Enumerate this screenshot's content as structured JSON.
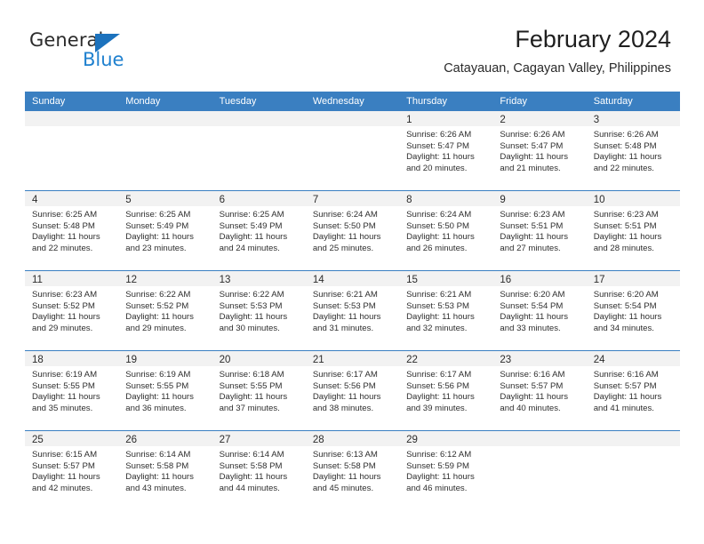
{
  "brand": {
    "word_one": "General",
    "word_two": "Blue",
    "flag_icon": "triangle-flag-icon",
    "accent_color": "#2081cf"
  },
  "header": {
    "title": "February 2024",
    "subtitle": "Catayauan, Cagayan Valley, Philippines"
  },
  "calendar": {
    "header_color": "#3a7fc1",
    "weekdays": [
      "Sunday",
      "Monday",
      "Tuesday",
      "Wednesday",
      "Thursday",
      "Friday",
      "Saturday"
    ],
    "weeks": [
      [
        {
          "day": "",
          "lines": []
        },
        {
          "day": "",
          "lines": []
        },
        {
          "day": "",
          "lines": []
        },
        {
          "day": "",
          "lines": []
        },
        {
          "day": "1",
          "lines": [
            "Sunrise: 6:26 AM",
            "Sunset: 5:47 PM",
            "Daylight: 11 hours",
            "and 20 minutes."
          ]
        },
        {
          "day": "2",
          "lines": [
            "Sunrise: 6:26 AM",
            "Sunset: 5:47 PM",
            "Daylight: 11 hours",
            "and 21 minutes."
          ]
        },
        {
          "day": "3",
          "lines": [
            "Sunrise: 6:26 AM",
            "Sunset: 5:48 PM",
            "Daylight: 11 hours",
            "and 22 minutes."
          ]
        }
      ],
      [
        {
          "day": "4",
          "lines": [
            "Sunrise: 6:25 AM",
            "Sunset: 5:48 PM",
            "Daylight: 11 hours",
            "and 22 minutes."
          ]
        },
        {
          "day": "5",
          "lines": [
            "Sunrise: 6:25 AM",
            "Sunset: 5:49 PM",
            "Daylight: 11 hours",
            "and 23 minutes."
          ]
        },
        {
          "day": "6",
          "lines": [
            "Sunrise: 6:25 AM",
            "Sunset: 5:49 PM",
            "Daylight: 11 hours",
            "and 24 minutes."
          ]
        },
        {
          "day": "7",
          "lines": [
            "Sunrise: 6:24 AM",
            "Sunset: 5:50 PM",
            "Daylight: 11 hours",
            "and 25 minutes."
          ]
        },
        {
          "day": "8",
          "lines": [
            "Sunrise: 6:24 AM",
            "Sunset: 5:50 PM",
            "Daylight: 11 hours",
            "and 26 minutes."
          ]
        },
        {
          "day": "9",
          "lines": [
            "Sunrise: 6:23 AM",
            "Sunset: 5:51 PM",
            "Daylight: 11 hours",
            "and 27 minutes."
          ]
        },
        {
          "day": "10",
          "lines": [
            "Sunrise: 6:23 AM",
            "Sunset: 5:51 PM",
            "Daylight: 11 hours",
            "and 28 minutes."
          ]
        }
      ],
      [
        {
          "day": "11",
          "lines": [
            "Sunrise: 6:23 AM",
            "Sunset: 5:52 PM",
            "Daylight: 11 hours",
            "and 29 minutes."
          ]
        },
        {
          "day": "12",
          "lines": [
            "Sunrise: 6:22 AM",
            "Sunset: 5:52 PM",
            "Daylight: 11 hours",
            "and 29 minutes."
          ]
        },
        {
          "day": "13",
          "lines": [
            "Sunrise: 6:22 AM",
            "Sunset: 5:53 PM",
            "Daylight: 11 hours",
            "and 30 minutes."
          ]
        },
        {
          "day": "14",
          "lines": [
            "Sunrise: 6:21 AM",
            "Sunset: 5:53 PM",
            "Daylight: 11 hours",
            "and 31 minutes."
          ]
        },
        {
          "day": "15",
          "lines": [
            "Sunrise: 6:21 AM",
            "Sunset: 5:53 PM",
            "Daylight: 11 hours",
            "and 32 minutes."
          ]
        },
        {
          "day": "16",
          "lines": [
            "Sunrise: 6:20 AM",
            "Sunset: 5:54 PM",
            "Daylight: 11 hours",
            "and 33 minutes."
          ]
        },
        {
          "day": "17",
          "lines": [
            "Sunrise: 6:20 AM",
            "Sunset: 5:54 PM",
            "Daylight: 11 hours",
            "and 34 minutes."
          ]
        }
      ],
      [
        {
          "day": "18",
          "lines": [
            "Sunrise: 6:19 AM",
            "Sunset: 5:55 PM",
            "Daylight: 11 hours",
            "and 35 minutes."
          ]
        },
        {
          "day": "19",
          "lines": [
            "Sunrise: 6:19 AM",
            "Sunset: 5:55 PM",
            "Daylight: 11 hours",
            "and 36 minutes."
          ]
        },
        {
          "day": "20",
          "lines": [
            "Sunrise: 6:18 AM",
            "Sunset: 5:55 PM",
            "Daylight: 11 hours",
            "and 37 minutes."
          ]
        },
        {
          "day": "21",
          "lines": [
            "Sunrise: 6:17 AM",
            "Sunset: 5:56 PM",
            "Daylight: 11 hours",
            "and 38 minutes."
          ]
        },
        {
          "day": "22",
          "lines": [
            "Sunrise: 6:17 AM",
            "Sunset: 5:56 PM",
            "Daylight: 11 hours",
            "and 39 minutes."
          ]
        },
        {
          "day": "23",
          "lines": [
            "Sunrise: 6:16 AM",
            "Sunset: 5:57 PM",
            "Daylight: 11 hours",
            "and 40 minutes."
          ]
        },
        {
          "day": "24",
          "lines": [
            "Sunrise: 6:16 AM",
            "Sunset: 5:57 PM",
            "Daylight: 11 hours",
            "and 41 minutes."
          ]
        }
      ],
      [
        {
          "day": "25",
          "lines": [
            "Sunrise: 6:15 AM",
            "Sunset: 5:57 PM",
            "Daylight: 11 hours",
            "and 42 minutes."
          ]
        },
        {
          "day": "26",
          "lines": [
            "Sunrise: 6:14 AM",
            "Sunset: 5:58 PM",
            "Daylight: 11 hours",
            "and 43 minutes."
          ]
        },
        {
          "day": "27",
          "lines": [
            "Sunrise: 6:14 AM",
            "Sunset: 5:58 PM",
            "Daylight: 11 hours",
            "and 44 minutes."
          ]
        },
        {
          "day": "28",
          "lines": [
            "Sunrise: 6:13 AM",
            "Sunset: 5:58 PM",
            "Daylight: 11 hours",
            "and 45 minutes."
          ]
        },
        {
          "day": "29",
          "lines": [
            "Sunrise: 6:12 AM",
            "Sunset: 5:59 PM",
            "Daylight: 11 hours",
            "and 46 minutes."
          ]
        },
        {
          "day": "",
          "lines": []
        },
        {
          "day": "",
          "lines": []
        }
      ]
    ]
  }
}
